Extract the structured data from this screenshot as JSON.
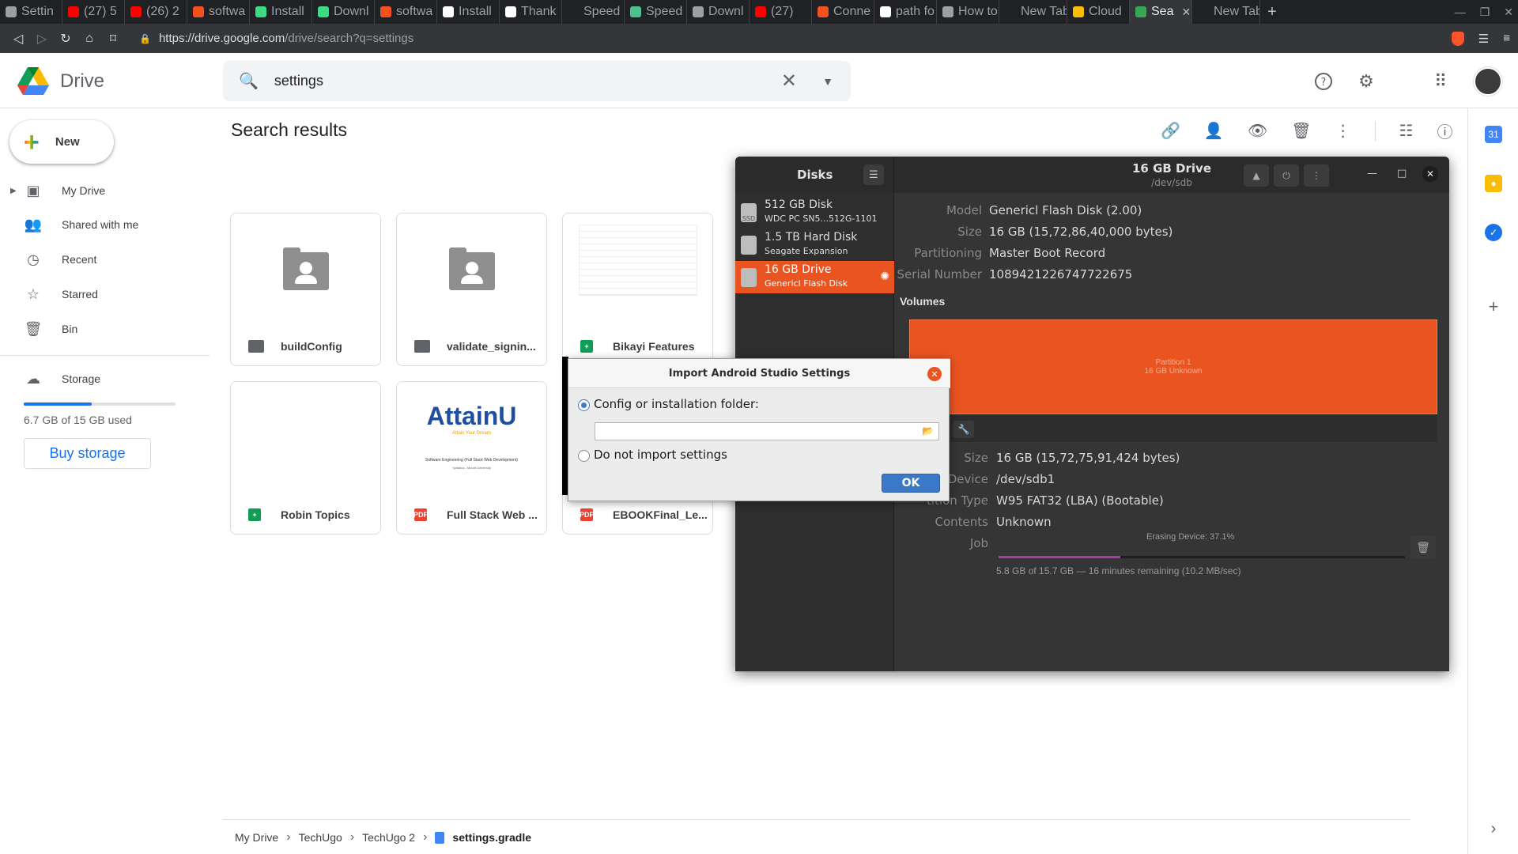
{
  "browser": {
    "tabs": [
      {
        "label": "Settin",
        "color": "#9aa0a6",
        "active": false
      },
      {
        "label": "(27) 5",
        "color": "#ff0000",
        "active": false
      },
      {
        "label": "(26) 2",
        "color": "#ff0000",
        "active": false
      },
      {
        "label": "softwa",
        "color": "#f4511e",
        "active": false
      },
      {
        "label": "Install",
        "color": "#3ddc84",
        "active": false
      },
      {
        "label": "Downl",
        "color": "#3ddc84",
        "active": false
      },
      {
        "label": "softwa",
        "color": "#f4511e",
        "active": false
      },
      {
        "label": "Install",
        "color": "#ffffff",
        "active": false
      },
      {
        "label": "Thank",
        "color": "#ffffff",
        "active": false
      },
      {
        "label": "Speed",
        "color": "#202124",
        "active": false
      },
      {
        "label": "Speed",
        "color": "#4fc08d",
        "active": false
      },
      {
        "label": "Downl",
        "color": "#9aa0a6",
        "active": false
      },
      {
        "label": "(27)",
        "color": "#ff0000",
        "active": false
      },
      {
        "label": "Conne",
        "color": "#f4511e",
        "active": false
      },
      {
        "label": "path fo",
        "color": "#ffffff",
        "active": false
      },
      {
        "label": "How to",
        "color": "#9aa0a6",
        "active": false
      },
      {
        "label": "New Tab",
        "color": "#202124",
        "active": false
      },
      {
        "label": "Cloud",
        "color": "#fbbc04",
        "active": false
      },
      {
        "label": "Sea",
        "color": "#34a853",
        "active": true
      },
      {
        "label": "New Tab",
        "color": "#202124",
        "active": false
      }
    ],
    "tab_close": "✕",
    "new_tab": "+",
    "url_host": "https://drive.google.com",
    "url_path": "/drive/search?q=settings"
  },
  "drive": {
    "app_name": "Drive",
    "search_value": "settings",
    "search_clear": "✕",
    "new_label": "New",
    "nav": [
      {
        "label": "My Drive",
        "icon": "my-drive-icon",
        "glyph": "▣"
      },
      {
        "label": "Shared with me",
        "icon": "people-icon",
        "glyph": "👥"
      },
      {
        "label": "Recent",
        "icon": "clock-icon",
        "glyph": "◷"
      },
      {
        "label": "Starred",
        "icon": "star-icon",
        "glyph": "☆"
      },
      {
        "label": "Bin",
        "icon": "trash-icon",
        "glyph": "🗑"
      }
    ],
    "storage_label": "Storage",
    "storage_used_fraction": 0.447,
    "storage_text": "6.7 GB of 15 GB used",
    "buy_storage": "Buy storage",
    "results_title": "Search results",
    "files": [
      {
        "name": "buildConfig",
        "type": "shared-folder"
      },
      {
        "name": "validate_signin...",
        "type": "shared-folder"
      },
      {
        "name": "Bikayi Features",
        "type": "sheet"
      },
      {
        "name": "Robin Topics",
        "type": "sheet"
      },
      {
        "name": "Full Stack Web ...",
        "type": "pdf"
      },
      {
        "name": "EBOOKFinal_Le...",
        "type": "pdf"
      }
    ],
    "attainu_logo": "AttainU",
    "attainu_tagline": "Attain Your Dream",
    "attainu_doc_line1": "Software Engineering (Full Stack Web Development)",
    "attainu_doc_line2": "Syllabus - Mount University",
    "pdf_badge": "PDF",
    "breadcrumb": [
      "My Drive",
      "TechUgo",
      "TechUgo 2",
      "settings.gradle"
    ]
  },
  "disks": {
    "title": "Disks",
    "drive_title": "16 GB Drive",
    "drive_device": "/dev/sdb",
    "list": [
      {
        "name": "512 GB Disk",
        "desc": "WDC PC SN5...512G-1101",
        "badge": "SSD",
        "selected": false
      },
      {
        "name": "1.5 TB Hard Disk",
        "desc": "Seagate Expansion",
        "badge": "",
        "selected": false
      },
      {
        "name": "16 GB Drive",
        "desc": "Genericl Flash Disk",
        "badge": "",
        "selected": true
      }
    ],
    "info": [
      {
        "key": "Model",
        "value": "Genericl Flash Disk (2.00)"
      },
      {
        "key": "Size",
        "value": "16 GB (15,72,86,40,000 bytes)"
      },
      {
        "key": "Partitioning",
        "value": "Master Boot Record"
      },
      {
        "key": "Serial Number",
        "value": "1089421226747722675"
      }
    ],
    "volumes_label": "Volumes",
    "partition_name": "Partition 1",
    "partition_desc": "16 GB Unknown",
    "volume_info": [
      {
        "key": "Size",
        "value": "16 GB (15,72,75,91,424 bytes)"
      },
      {
        "key": "Device",
        "value": "/dev/sdb1"
      },
      {
        "key": "Partition Type",
        "value": "W95 FAT32 (LBA) (Bootable)"
      },
      {
        "key": "Contents",
        "value": "Unknown"
      },
      {
        "key": "Job",
        "value": ""
      }
    ],
    "job_label": "Erasing Device: 37.1%",
    "job_progress": 0.3,
    "job_text": "5.8 GB of 15.7 GB — 16 minutes remaining (10.2 MB/sec)"
  },
  "dialog": {
    "title": "Import Android Studio Settings",
    "option1": "Config or installation folder:",
    "option2": "Do not import settings",
    "path_value": "",
    "ok": "OK"
  }
}
